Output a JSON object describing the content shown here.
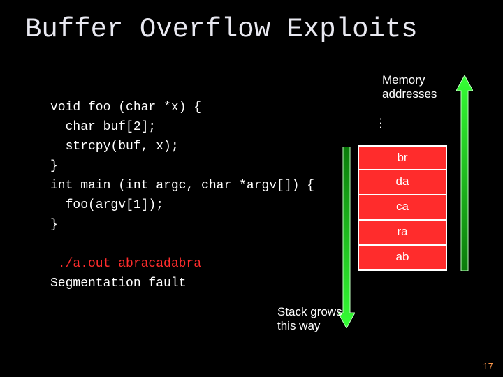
{
  "title": "Buffer Overflow Exploits",
  "code": {
    "l1": "void foo (char *x) {",
    "l2": "  char buf[2];",
    "l3": "  strcpy(buf, x);",
    "l4": "}",
    "l5": "int main (int argc, char *argv[]) {",
    "l6": "  foo(argv[1]);",
    "l7": "}",
    "blank": "",
    "cmd": " ./a.out abracadabra",
    "out": "Segmentation fault"
  },
  "memory_label_l1": "Memory",
  "memory_label_l2": "addresses",
  "dots": "...",
  "stack": {
    "c0": "br",
    "c1": "da",
    "c2": "ca",
    "c3": "ra",
    "c4": "ab"
  },
  "grows_l1": "Stack grows",
  "grows_l2": "this way",
  "page_number": "17"
}
